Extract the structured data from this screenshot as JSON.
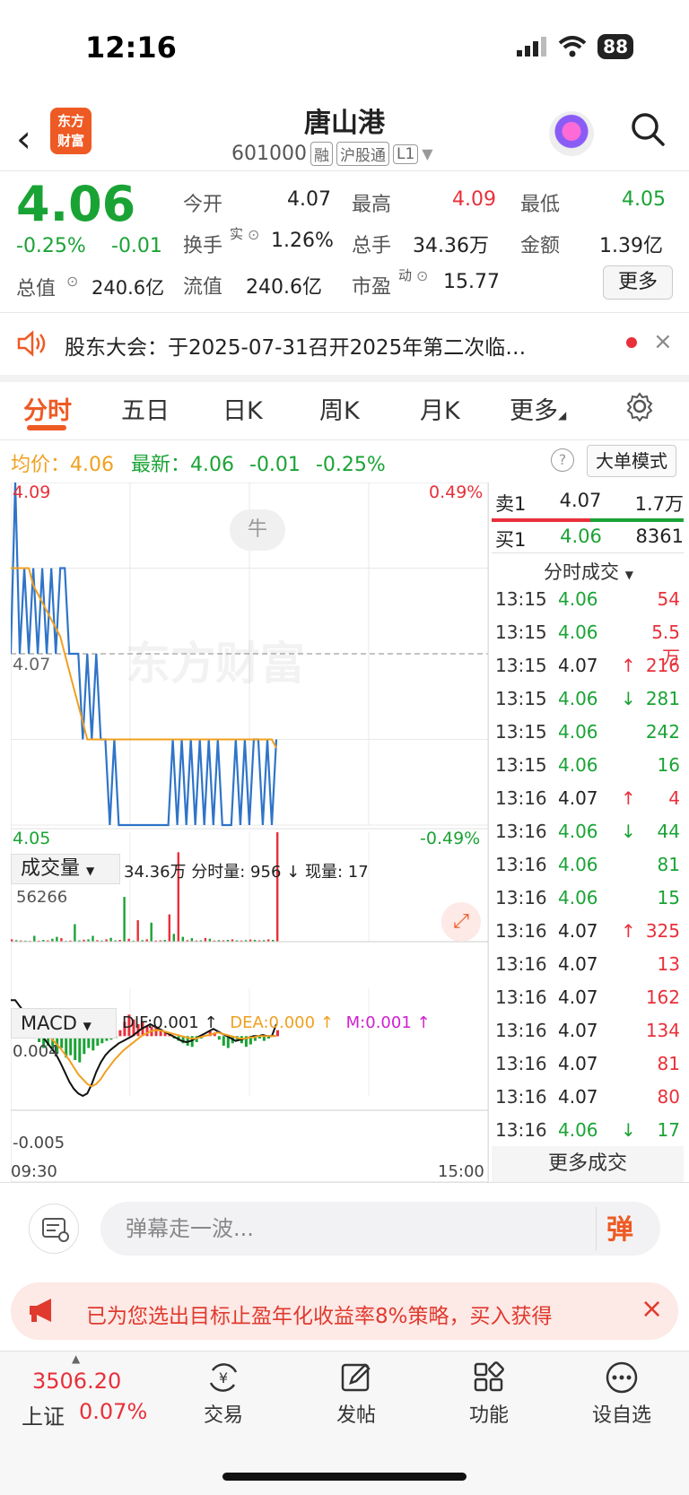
{
  "status": {
    "time": "12:16",
    "battery": "88"
  },
  "header": {
    "logo_line1": "东方",
    "logo_line2": "财富",
    "name": "唐山港",
    "code": "601000",
    "tags": [
      "融",
      "沪股通",
      "L1"
    ]
  },
  "quote": {
    "price": "4.06",
    "change_pct": "-0.25%",
    "change": "-0.01",
    "open_label": "今开",
    "open": "4.07",
    "high_label": "最高",
    "high": "4.09",
    "low_label": "最低",
    "low": "4.05",
    "turnover_label": "换手",
    "turnover_sup": "实",
    "turnover": "1.26%",
    "volume_label": "总手",
    "volume": "34.36万",
    "amount_label": "金额",
    "amount": "1.39亿",
    "mcap_label": "总值",
    "mcap": "240.6亿",
    "float_label": "流值",
    "float": "240.6亿",
    "pe_label": "市盈",
    "pe_sup": "动",
    "pe": "15.77",
    "more": "更多"
  },
  "notice": {
    "text": "股东大会：于2025-07-31召开2025年第二次临…"
  },
  "tabs": [
    "分时",
    "五日",
    "日K",
    "周K",
    "月K",
    "更多"
  ],
  "avg_row": {
    "avg_label": "均价：",
    "avg": "4.06",
    "latest_label": "最新：",
    "latest": "4.06",
    "latest_change": "-0.01",
    "latest_pct": "-0.25%",
    "mode": "大单模式"
  },
  "chart_data": [
    {
      "type": "line",
      "title": "分时",
      "y_labels": {
        "top": "4.09",
        "mid": "4.07",
        "bottom": "4.05",
        "top_pct": "0.49%",
        "bottom_pct": "-0.49%"
      },
      "ylim": [
        4.05,
        4.09
      ],
      "x_labels": [
        "09:30",
        "15:00"
      ],
      "series": [
        {
          "values": [
            4.07,
            4.09,
            4.07,
            4.08,
            4.07,
            4.08,
            4.07,
            4.08,
            4.07,
            4.08,
            4.07,
            4.08,
            4.08,
            4.07,
            4.07,
            4.07,
            4.06,
            4.07,
            4.06,
            4.07,
            4.06,
            4.06,
            4.05,
            4.06,
            4.05,
            4.05,
            4.05,
            4.05,
            4.05,
            4.05,
            4.05,
            4.05,
            4.05,
            4.05,
            4.05,
            4.05,
            4.06,
            4.05,
            4.06,
            4.05,
            4.06,
            4.05,
            4.06,
            4.05,
            4.06,
            4.05,
            4.06,
            4.05,
            4.05,
            4.05,
            4.06,
            4.05,
            4.06,
            4.05,
            4.06,
            4.06,
            4.05,
            4.06,
            4.05,
            4.06
          ]
        },
        {
          "values": [
            4.08,
            4.08,
            4.08,
            4.08,
            4.08,
            4.078,
            4.077,
            4.076,
            4.075,
            4.074,
            4.073,
            4.072,
            4.07,
            4.068,
            4.066,
            4.064,
            4.062,
            4.06,
            4.06,
            4.06,
            4.06,
            4.06,
            4.06,
            4.06,
            4.06,
            4.06,
            4.06,
            4.06,
            4.06,
            4.06,
            4.06,
            4.06,
            4.06,
            4.06,
            4.06,
            4.06,
            4.06,
            4.06,
            4.06,
            4.06,
            4.06,
            4.06,
            4.06,
            4.06,
            4.06,
            4.06,
            4.06,
            4.06,
            4.06,
            4.06,
            4.06,
            4.06,
            4.06,
            4.06,
            4.06,
            4.06,
            4.06,
            4.06,
            4.06,
            4.059
          ]
        }
      ]
    },
    {
      "type": "bar",
      "title": "成交量",
      "volume_label": "34.36万",
      "minute_vol_label": "分时量: 956",
      "current_vol_label": "现量: 17",
      "ymax_label": "56266",
      "values": [
        1200,
        800,
        600,
        500,
        400,
        3000,
        500,
        900,
        700,
        1500,
        2500,
        1800,
        400,
        600,
        9000,
        700,
        1000,
        1200,
        3000,
        800,
        600,
        1200,
        2000,
        700,
        900,
        23000,
        1500,
        500,
        11000,
        800,
        1200,
        9800,
        600,
        700,
        900,
        14000,
        4000,
        46000,
        2500,
        800,
        1800,
        600,
        700,
        1900,
        1500,
        600,
        800,
        700,
        900,
        1200,
        700,
        600,
        800,
        1100,
        900,
        700,
        800,
        1200,
        900,
        56266
      ],
      "colors": [
        "r",
        "g",
        "r",
        "g",
        "r",
        "g",
        "r",
        "g",
        "r",
        "g",
        "g",
        "r",
        "g",
        "r",
        "g",
        "g",
        "r",
        "g",
        "g",
        "r",
        "g",
        "r",
        "g",
        "g",
        "r",
        "g",
        "r",
        "g",
        "r",
        "g",
        "r",
        "g",
        "r",
        "r",
        "g",
        "r",
        "g",
        "r",
        "g",
        "r",
        "g",
        "r",
        "g",
        "r",
        "g",
        "r",
        "g",
        "r",
        "g",
        "r",
        "g",
        "r",
        "g",
        "r",
        "g",
        "r",
        "g",
        "r",
        "g",
        "r"
      ]
    },
    {
      "type": "bar",
      "title": "MACD",
      "dif_label": "DIF:0.001",
      "dea_label": "DEA:0.000",
      "m_label": "M:0.001",
      "ymax_label": "0.004",
      "ymin_label": "-0.005",
      "ylim": [
        -0.005,
        0.004
      ],
      "values": [
        0.002,
        0.0018,
        0.0012,
        0.0008,
        0.0004,
        0.0,
        -0.0005,
        -0.001,
        -0.0008,
        -0.0012,
        -0.0015,
        -0.001,
        -0.0018,
        -0.0016,
        -0.002,
        -0.0022,
        -0.0015,
        -0.001,
        -0.0012,
        -0.0008,
        -0.0006,
        -0.0004,
        -0.0003,
        -0.0002,
        0.0005,
        0.0012,
        0.0018,
        0.0014,
        0.001,
        0.0012,
        0.0009,
        0.0008,
        0.0007,
        0.0006,
        0.0004,
        0.0002,
        -0.0002,
        -0.0004,
        -0.0006,
        -0.0008,
        -0.0009,
        -0.0005,
        -0.0002,
        0.0001,
        0.0004,
        0.0003,
        -0.0003,
        -0.0008,
        -0.001,
        -0.0006,
        -0.0003,
        -0.0006,
        -0.0009,
        -0.0007,
        -0.0004,
        -0.0002,
        -0.0004,
        -0.0002,
        0.0001,
        0.0005
      ],
      "dif": [
        0.003,
        0.003,
        0.0025,
        0.002,
        0.002,
        0.0015,
        0.001,
        0.0,
        -0.0005,
        -0.001,
        -0.0015,
        -0.0022,
        -0.003,
        -0.0038,
        -0.0044,
        -0.0048,
        -0.005,
        -0.0048,
        -0.004,
        -0.003,
        -0.0022,
        -0.0016,
        -0.0012,
        -0.0009,
        -0.0006,
        -0.0004,
        -0.0002,
        0.0,
        0.0003,
        0.0006,
        0.0008,
        0.001,
        0.0008,
        0.0006,
        0.0004,
        0.0002,
        0.0,
        -0.0002,
        -0.0004,
        -0.0005,
        -0.0004,
        -0.0002,
        0.0,
        0.0002,
        0.0004,
        0.0006,
        0.0004,
        0.0002,
        0.0,
        -0.0002,
        -0.0004,
        -0.0003,
        -0.0002,
        -0.0001,
        0.0,
        0.0,
        0.0001,
        0.0,
        0.0,
        0.001
      ],
      "dea": [
        0.002,
        0.002,
        0.0018,
        0.0016,
        0.0014,
        0.0012,
        0.001,
        0.0006,
        0.0002,
        -0.0002,
        -0.0006,
        -0.001,
        -0.0015,
        -0.002,
        -0.0026,
        -0.0032,
        -0.0036,
        -0.004,
        -0.0042,
        -0.004,
        -0.0036,
        -0.003,
        -0.0025,
        -0.002,
        -0.0016,
        -0.0012,
        -0.0009,
        -0.0006,
        -0.0003,
        0.0,
        0.0002,
        0.0004,
        0.0005,
        0.0005,
        0.0004,
        0.0003,
        0.0002,
        0.0001,
        0.0,
        -0.0001,
        -0.0002,
        -0.0002,
        -0.0001,
        0.0,
        0.0001,
        0.0002,
        0.0003,
        0.0002,
        0.0001,
        0.0,
        -0.0001,
        -0.0002,
        -0.0002,
        -0.0001,
        -0.0001,
        0.0,
        0.0,
        0.0,
        0.0,
        0.0
      ]
    }
  ],
  "chart_ui": {
    "bull_tag": "牛",
    "volume_dropdown": "成交量",
    "macd_dropdown": "MACD",
    "watermark": "东方财富"
  },
  "orderbook": {
    "sell1_label": "卖1",
    "sell1_price": "4.07",
    "sell1_vol": "1.7万",
    "buy1_label": "买1",
    "buy1_price": "4.06",
    "buy1_vol": "8361",
    "trades_title": "分时成交",
    "trades": [
      {
        "t": "13:15",
        "p": "4.06",
        "v": "54",
        "pc": "g",
        "vc": "r",
        "arrow": ""
      },
      {
        "t": "13:15",
        "p": "4.06",
        "v": "5.5万",
        "pc": "g",
        "vc": "r",
        "arrow": ""
      },
      {
        "t": "13:15",
        "p": "4.07",
        "v": "216",
        "pc": "k",
        "vc": "r",
        "arrow": "↑"
      },
      {
        "t": "13:15",
        "p": "4.06",
        "v": "281",
        "pc": "g",
        "vc": "g",
        "arrow": "↓"
      },
      {
        "t": "13:15",
        "p": "4.06",
        "v": "242",
        "pc": "g",
        "vc": "g",
        "arrow": ""
      },
      {
        "t": "13:15",
        "p": "4.06",
        "v": "16",
        "pc": "g",
        "vc": "g",
        "arrow": ""
      },
      {
        "t": "13:16",
        "p": "4.07",
        "v": "4",
        "pc": "k",
        "vc": "r",
        "arrow": "↑"
      },
      {
        "t": "13:16",
        "p": "4.06",
        "v": "44",
        "pc": "g",
        "vc": "g",
        "arrow": "↓"
      },
      {
        "t": "13:16",
        "p": "4.06",
        "v": "81",
        "pc": "g",
        "vc": "g",
        "arrow": ""
      },
      {
        "t": "13:16",
        "p": "4.06",
        "v": "15",
        "pc": "g",
        "vc": "g",
        "arrow": ""
      },
      {
        "t": "13:16",
        "p": "4.07",
        "v": "325",
        "pc": "k",
        "vc": "r",
        "arrow": "↑"
      },
      {
        "t": "13:16",
        "p": "4.07",
        "v": "13",
        "pc": "k",
        "vc": "r",
        "arrow": ""
      },
      {
        "t": "13:16",
        "p": "4.07",
        "v": "162",
        "pc": "k",
        "vc": "r",
        "arrow": ""
      },
      {
        "t": "13:16",
        "p": "4.07",
        "v": "134",
        "pc": "k",
        "vc": "r",
        "arrow": ""
      },
      {
        "t": "13:16",
        "p": "4.07",
        "v": "81",
        "pc": "k",
        "vc": "r",
        "arrow": ""
      },
      {
        "t": "13:16",
        "p": "4.07",
        "v": "80",
        "pc": "k",
        "vc": "r",
        "arrow": ""
      },
      {
        "t": "13:16",
        "p": "4.06",
        "v": "17",
        "pc": "g",
        "vc": "g",
        "arrow": "↓"
      }
    ],
    "more_trades": "更多成交"
  },
  "danmaku": {
    "placeholder": "弹幕走一波...",
    "send": "弹"
  },
  "promo": {
    "text": "已为您选出目标止盈年化收益率8%策略，买入获得"
  },
  "nav": {
    "index_value": "3506.20",
    "index_name": "上证",
    "index_pct": "0.07%",
    "items": [
      "交易",
      "发帖",
      "功能",
      "设自选"
    ]
  },
  "colors": {
    "up": "#e8303a",
    "down": "#1aa335",
    "accent": "#ee5a24",
    "avg_line": "#f0a020",
    "price_line": "#2f74c8"
  }
}
